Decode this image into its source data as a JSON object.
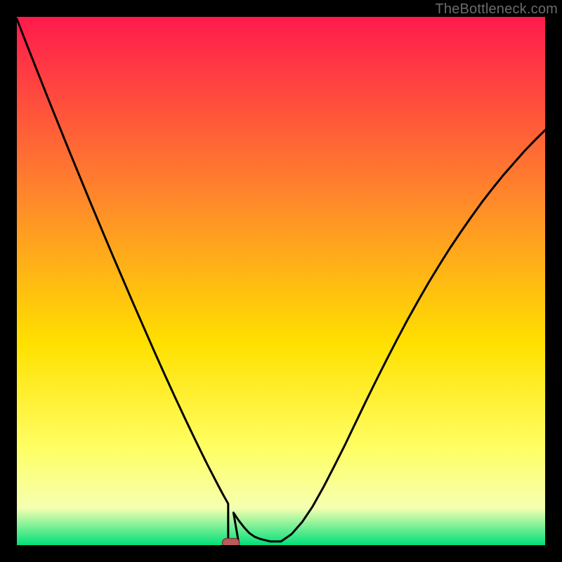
{
  "attribution": "TheBottleneck.com",
  "colors": {
    "frame_bg": "#000000",
    "gradient_top": "#ff1a4d",
    "gradient_mid1": "#ff8a2a",
    "gradient_mid2": "#ffe100",
    "gradient_low1": "#ffff66",
    "gradient_low2": "#f5ffb0",
    "gradient_bottom": "#00e07a",
    "curve": "#000000",
    "marker_fill": "#bb5a5a",
    "marker_stroke": "#7a3a3a"
  },
  "chart_data": {
    "type": "line",
    "title": "",
    "xlabel": "",
    "ylabel": "",
    "xlim": [
      0,
      100
    ],
    "ylim": [
      0,
      100
    ],
    "x": [
      0,
      2,
      4,
      6,
      8,
      10,
      12,
      14,
      16,
      18,
      20,
      22,
      24,
      26,
      28,
      30,
      32,
      34,
      36,
      38,
      39,
      40,
      41,
      42,
      43,
      44,
      45,
      46,
      48,
      50,
      52,
      54,
      56,
      58,
      60,
      62,
      64,
      66,
      68,
      70,
      72,
      74,
      76,
      78,
      80,
      82,
      84,
      86,
      88,
      90,
      92,
      94,
      96,
      98,
      100
    ],
    "values": [
      100,
      94.8,
      89.7,
      84.6,
      79.6,
      74.6,
      69.7,
      64.8,
      60.0,
      55.2,
      50.5,
      45.8,
      41.2,
      36.6,
      32.1,
      27.7,
      23.4,
      19.2,
      15.1,
      11.2,
      9.3,
      7.5,
      5.8,
      4.3,
      3.0,
      1.9,
      1.2,
      0.8,
      0.3,
      0.3,
      1.7,
      4.0,
      7.0,
      10.6,
      14.5,
      18.5,
      22.7,
      26.9,
      31.0,
      35.0,
      38.9,
      42.7,
      46.3,
      49.8,
      53.1,
      56.3,
      59.3,
      62.2,
      65.0,
      67.6,
      70.1,
      72.4,
      74.7,
      76.8,
      78.8
    ],
    "flat_zone": {
      "x_start": 40,
      "x_end": 42,
      "y": 0
    },
    "marker": {
      "x": 40.5,
      "y": 0
    }
  }
}
